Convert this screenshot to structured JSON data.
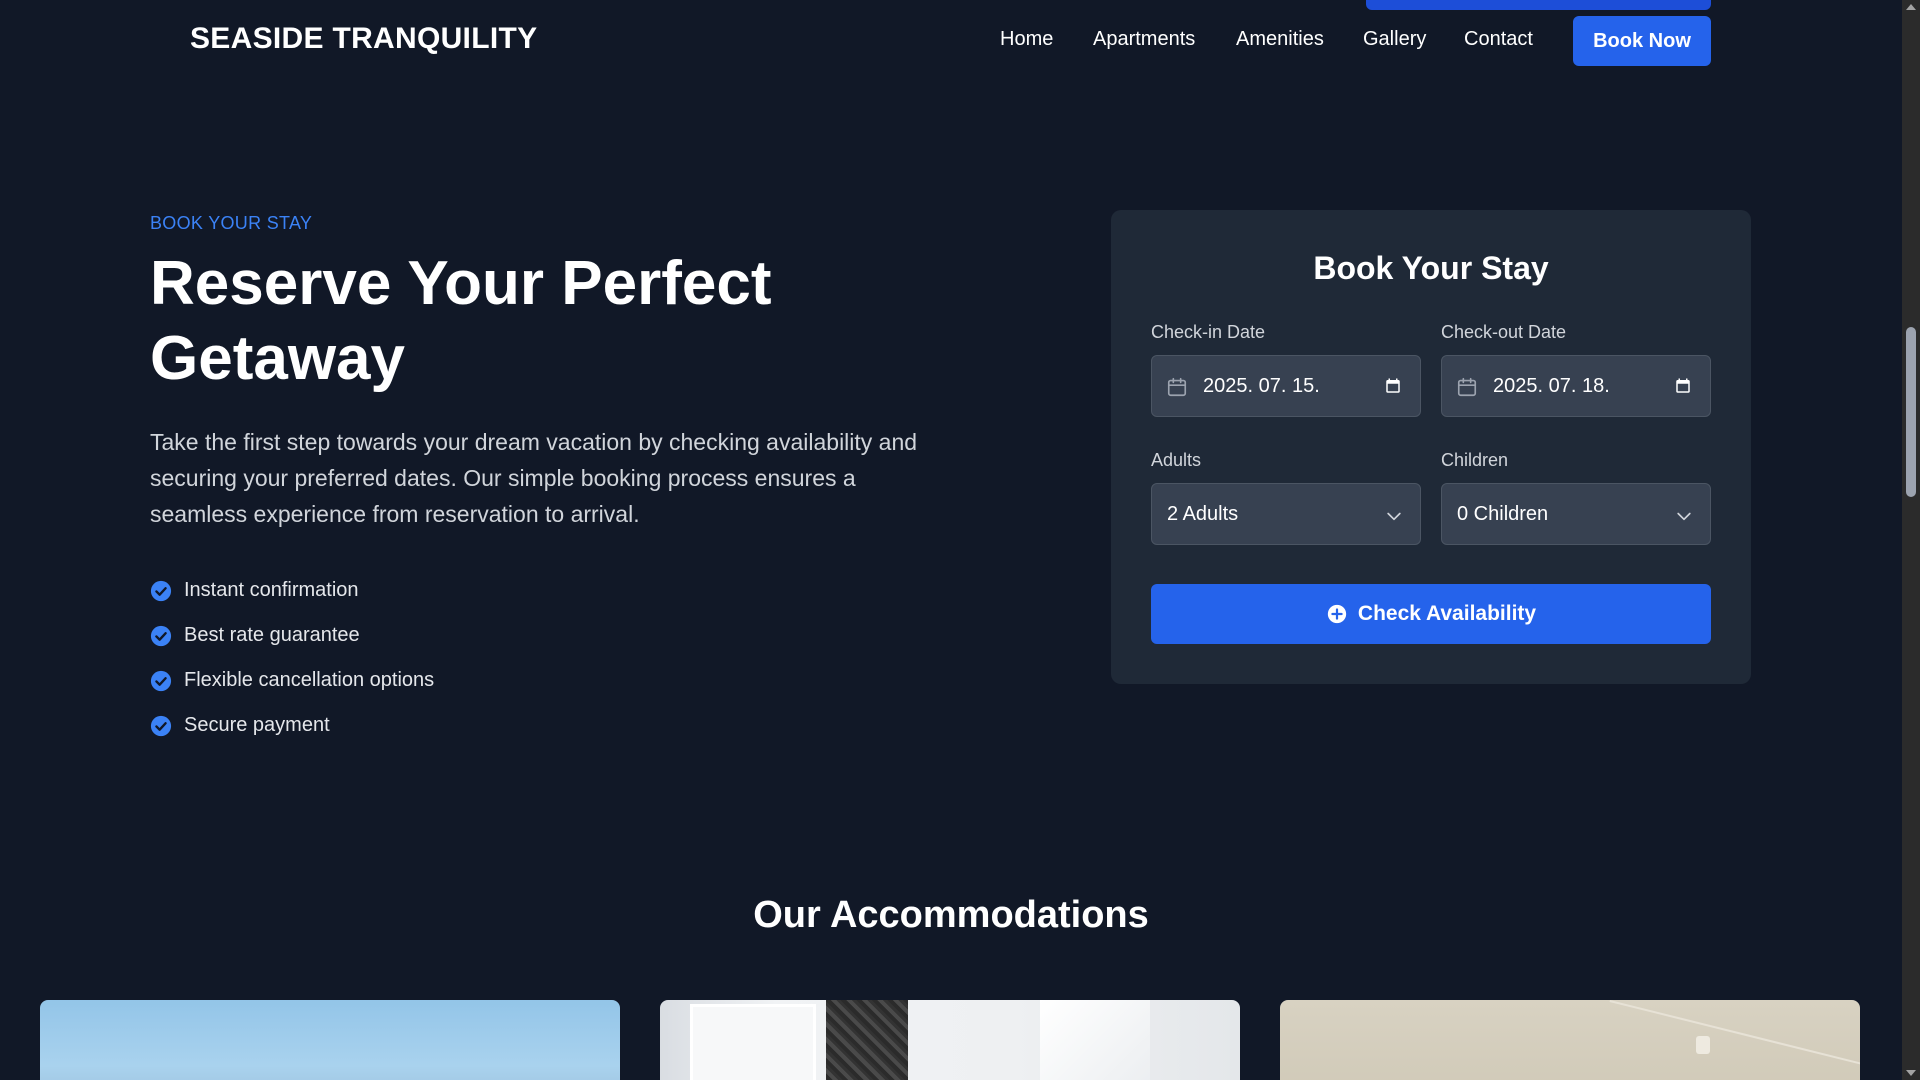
{
  "header": {
    "logo": "SEASIDE TRANQUILITY",
    "nav": [
      "Home",
      "Apartments",
      "Amenities",
      "Gallery",
      "Contact"
    ],
    "cta_label": "Book Now"
  },
  "hero": {
    "eyebrow": "BOOK YOUR STAY",
    "title": "Reserve Your Perfect Getaway",
    "description": "Take the first step towards your dream vacation by checking availability and securing your preferred dates. Our simple booking process ensures a seamless experience from reservation to arrival.",
    "features": [
      "Instant confirmation",
      "Best rate guarantee",
      "Flexible cancellation options",
      "Secure payment"
    ]
  },
  "booking": {
    "title": "Book Your Stay",
    "checkin_label": "Check-in Date",
    "checkin_value": "2025. 07. 15.",
    "checkout_label": "Check-out Date",
    "checkout_value": "2025. 07. 18.",
    "adults_label": "Adults",
    "adults_value": "2 Adults",
    "children_label": "Children",
    "children_value": "0 Children",
    "submit_label": "Check Availability"
  },
  "accommodations": {
    "title": "Our Accommodations"
  },
  "colors": {
    "background": "#111827",
    "card": "#1f2937",
    "accent": "#2563eb",
    "eyebrow": "#3b82f6"
  },
  "icons": {
    "feature": "check-circle-icon",
    "date_lead": "calendar-icon",
    "date_trail": "calendar-picker-icon",
    "select": "chevron-down-icon",
    "submit": "plus-circle-icon"
  }
}
